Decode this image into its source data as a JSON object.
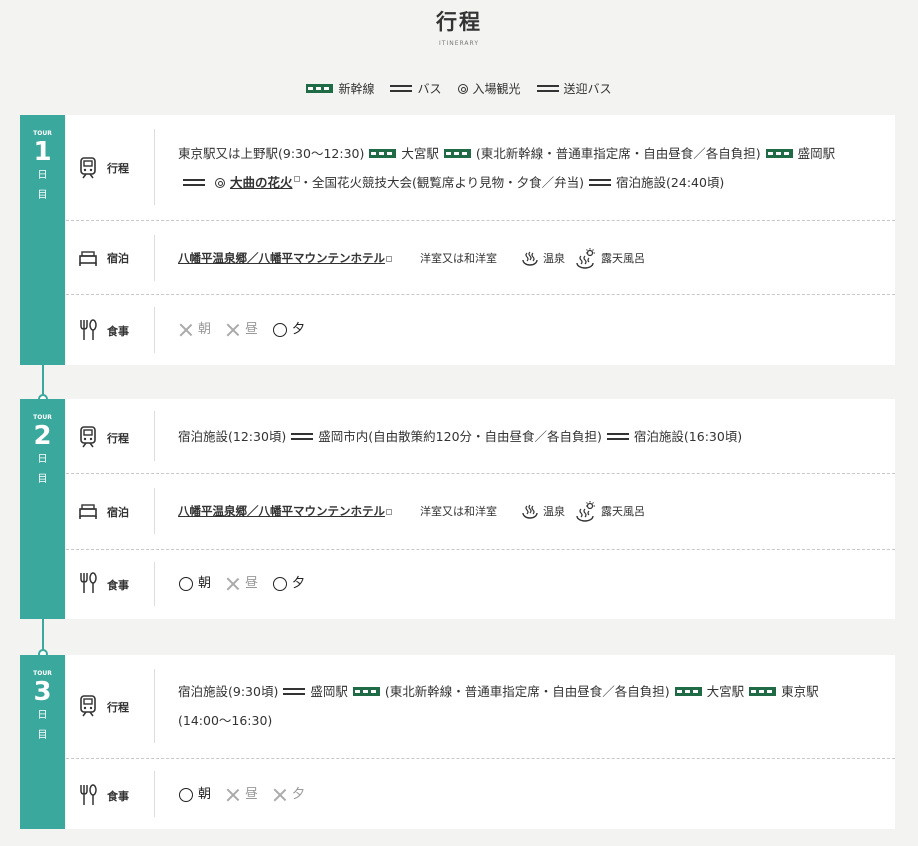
{
  "header": {
    "title": "行程",
    "subtitle": "ITINERARY"
  },
  "legend": [
    {
      "symbol": "rail",
      "label": "新幹線"
    },
    {
      "symbol": "bus",
      "label": "バス"
    },
    {
      "symbol": "spot",
      "label": "入場観光"
    },
    {
      "symbol": "bus",
      "label": "送迎バス"
    }
  ],
  "labels": {
    "route": "行程",
    "stay": "宿泊",
    "meals": "食事",
    "tour": "TOUR",
    "day_char": "日",
    "me_char": "目"
  },
  "meal_names": {
    "breakfast": "朝",
    "lunch": "昼",
    "dinner": "夕"
  },
  "hotel": {
    "name": "八幡平温泉郷／八幡平マウンテンホテル",
    "room": "洋室又は和洋室",
    "onsen": "温泉",
    "rotenburo": "露天風呂"
  },
  "days": [
    {
      "num": "1",
      "route": [
        "東京駅又は上野駅(9:30〜12:30)",
        "大宮駅",
        "(東北新幹線・普通車指定席・自由昼食／各自負担)",
        "盛岡駅",
        "大曲の花火",
        "・全国花火競技大会(観覧席より見物・夕食／弁当)",
        "宿泊施設(24:40頃)"
      ],
      "meals": {
        "breakfast": false,
        "lunch": false,
        "dinner": true
      }
    },
    {
      "num": "2",
      "route": [
        "宿泊施設(12:30頃)",
        "盛岡市内(自由散策約120分・自由昼食／各自負担)",
        "宿泊施設(16:30頃)"
      ],
      "meals": {
        "breakfast": true,
        "lunch": false,
        "dinner": true
      }
    },
    {
      "num": "3",
      "route": [
        "宿泊施設(9:30頃)",
        "盛岡駅",
        "(東北新幹線・普通車指定席・自由昼食／各自負担)",
        "大宮駅",
        "東京駅",
        "(14:00〜16:30)"
      ],
      "meals": {
        "breakfast": true,
        "lunch": false,
        "dinner": false
      }
    }
  ],
  "colors": {
    "accent": "#3aa89d",
    "rail": "#1e6b45"
  },
  "icons": {
    "route": "train-icon",
    "stay": "bed-icon",
    "meals": "cutlery-icon",
    "onsen": "onsen-icon",
    "rotenburo": "rotenburo-icon"
  }
}
